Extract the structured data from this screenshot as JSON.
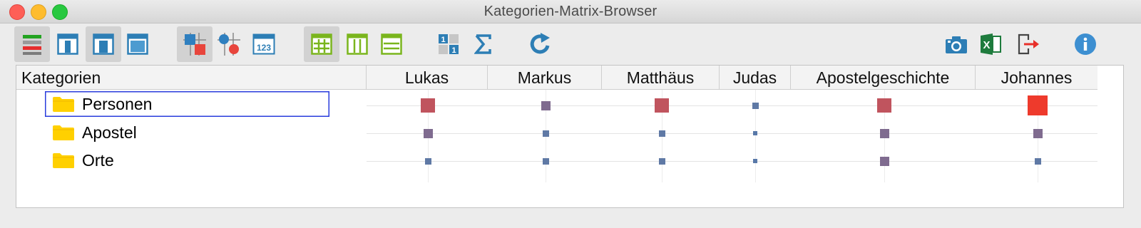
{
  "window": {
    "title": "Kategorien-Matrix-Browser"
  },
  "toolbar": {
    "buttons": [
      {
        "icon": "segments-colored-list-icon",
        "active": true
      },
      {
        "icon": "left-pane-layout-icon",
        "active": false
      },
      {
        "icon": "center-pane-layout-icon",
        "active": true
      },
      {
        "icon": "full-pane-layout-icon",
        "active": false
      },
      {
        "icon": "squares-view-icon",
        "active": true
      },
      {
        "icon": "circles-view-icon",
        "active": false
      },
      {
        "icon": "numbers-view-icon",
        "active": false
      },
      {
        "icon": "grid-lines-icon",
        "active": true
      },
      {
        "icon": "column-lines-icon",
        "active": false
      },
      {
        "icon": "row-lines-icon",
        "active": false
      },
      {
        "icon": "binary-matrix-icon",
        "active": false
      },
      {
        "icon": "sum-icon",
        "active": false
      },
      {
        "icon": "refresh-icon",
        "active": false
      },
      {
        "icon": "camera-icon",
        "active": false
      },
      {
        "icon": "excel-export-icon",
        "active": false
      },
      {
        "icon": "export-icon",
        "active": false
      },
      {
        "icon": "info-icon",
        "active": false
      }
    ]
  },
  "matrix": {
    "first_column_header": "Kategorien",
    "columns": [
      "Lukas",
      "Markus",
      "Matthäus",
      "Judas",
      "Apostelgeschichte",
      "Johannes"
    ],
    "rows": [
      {
        "label": "Personen",
        "selected": true,
        "cells": [
          5,
          3,
          5,
          2,
          5,
          7
        ]
      },
      {
        "label": "Apostel",
        "selected": false,
        "cells": [
          3,
          2,
          2,
          1,
          3,
          3
        ]
      },
      {
        "label": "Orte",
        "selected": false,
        "cells": [
          2,
          2,
          2,
          1,
          3,
          2
        ]
      }
    ],
    "legend_note": "cells: relative symbol size level (1 = smallest, 7 = largest)",
    "level_colors": {
      "1": "#5878a8",
      "2": "#5f79a5",
      "3": "#7f6b8f",
      "5": "#c0545e",
      "7": "#ee3a2c"
    }
  }
}
